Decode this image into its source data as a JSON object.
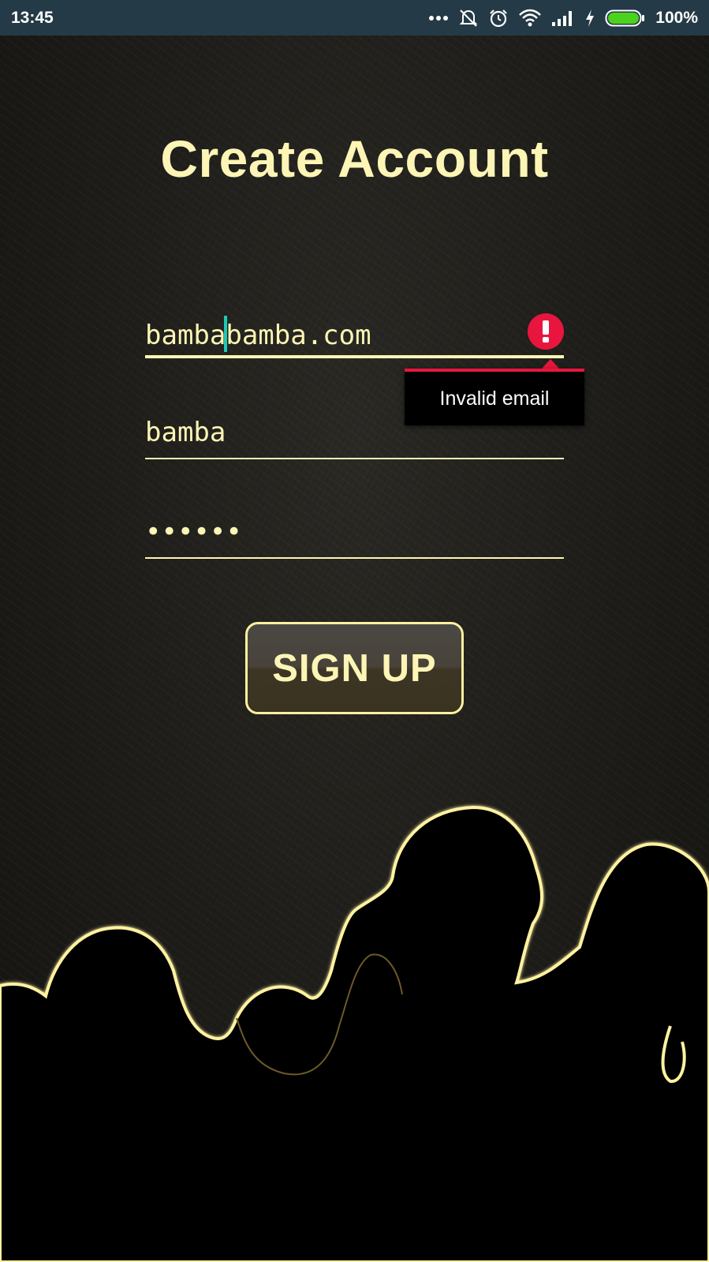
{
  "status_bar": {
    "time": "13:45",
    "battery_percent": "100%",
    "icons": [
      "more-dots-icon",
      "mute-notification-icon",
      "alarm-icon",
      "wifi-icon",
      "signal-icon",
      "charging-icon",
      "battery-icon"
    ]
  },
  "form": {
    "title": "Create Account",
    "email": {
      "before_caret": "bamba",
      "after_caret": "bamba.com",
      "error": "Invalid email"
    },
    "name": {
      "value": "bamba"
    },
    "password": {
      "value": "••••••"
    },
    "submit_label": "SIGN UP"
  },
  "colors": {
    "accent_text": "#fdf5b5",
    "error": "#e8163e",
    "caret": "#1fc7b5",
    "status_bar": "#253a47"
  }
}
